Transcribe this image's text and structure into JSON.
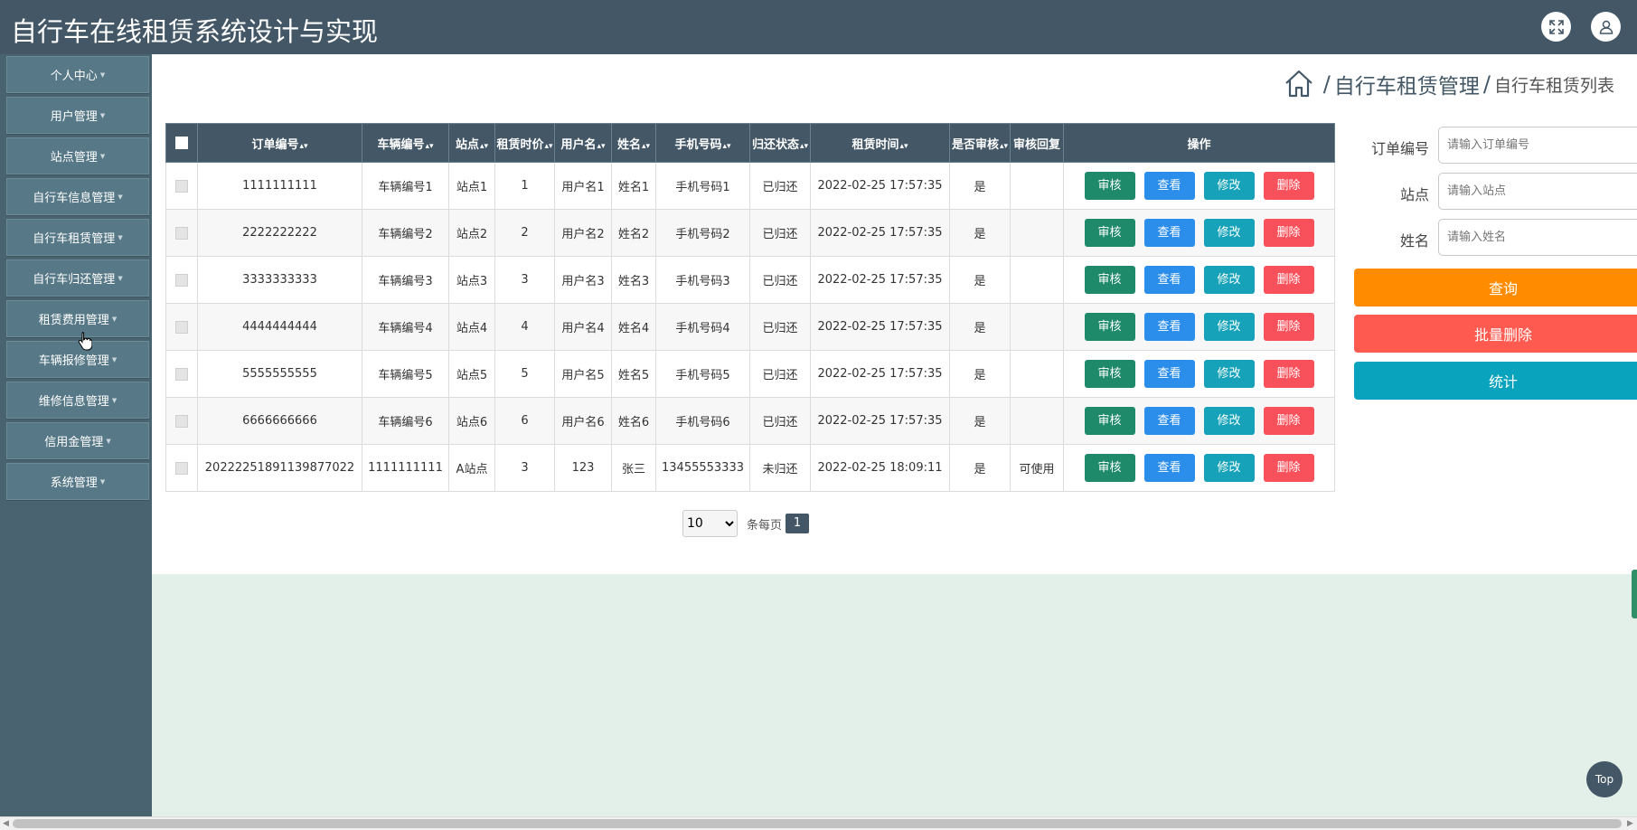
{
  "app": {
    "title": "自行车在线租赁系统设计与实现"
  },
  "header_icons": [
    "fullscreen-icon",
    "user-icon"
  ],
  "sidebar": {
    "items": [
      {
        "label": "个人中心"
      },
      {
        "label": "用户管理"
      },
      {
        "label": "站点管理"
      },
      {
        "label": "自行车信息管理"
      },
      {
        "label": "自行车租赁管理"
      },
      {
        "label": "自行车归还管理"
      },
      {
        "label": "租赁费用管理"
      },
      {
        "label": "车辆报修管理"
      },
      {
        "label": "维修信息管理"
      },
      {
        "label": "信用金管理"
      },
      {
        "label": "系统管理"
      }
    ]
  },
  "breadcrumb": {
    "section": "自行车租赁管理",
    "page": "自行车租赁列表",
    "separator": "/"
  },
  "table": {
    "columns": [
      "订单编号",
      "车辆编号",
      "站点",
      "租赁时价",
      "用户名",
      "姓名",
      "手机号码",
      "归还状态",
      "租赁时间",
      "是否审核",
      "审核回复",
      "操作"
    ],
    "actions": {
      "audit": "审核",
      "view": "查看",
      "edit": "修改",
      "delete": "删除"
    },
    "rows": [
      {
        "order": "1111111111",
        "bike": "车辆编号1",
        "station": "站点1",
        "price": "1",
        "username": "用户名1",
        "name": "姓名1",
        "phone": "手机号码1",
        "status": "已归还",
        "time": "2022-02-25 17:57:35",
        "audited": "是",
        "reply": ""
      },
      {
        "order": "2222222222",
        "bike": "车辆编号2",
        "station": "站点2",
        "price": "2",
        "username": "用户名2",
        "name": "姓名2",
        "phone": "手机号码2",
        "status": "已归还",
        "time": "2022-02-25 17:57:35",
        "audited": "是",
        "reply": ""
      },
      {
        "order": "3333333333",
        "bike": "车辆编号3",
        "station": "站点3",
        "price": "3",
        "username": "用户名3",
        "name": "姓名3",
        "phone": "手机号码3",
        "status": "已归还",
        "time": "2022-02-25 17:57:35",
        "audited": "是",
        "reply": ""
      },
      {
        "order": "4444444444",
        "bike": "车辆编号4",
        "station": "站点4",
        "price": "4",
        "username": "用户名4",
        "name": "姓名4",
        "phone": "手机号码4",
        "status": "已归还",
        "time": "2022-02-25 17:57:35",
        "audited": "是",
        "reply": ""
      },
      {
        "order": "5555555555",
        "bike": "车辆编号5",
        "station": "站点5",
        "price": "5",
        "username": "用户名5",
        "name": "姓名5",
        "phone": "手机号码5",
        "status": "已归还",
        "time": "2022-02-25 17:57:35",
        "audited": "是",
        "reply": ""
      },
      {
        "order": "6666666666",
        "bike": "车辆编号6",
        "station": "站点6",
        "price": "6",
        "username": "用户名6",
        "name": "姓名6",
        "phone": "手机号码6",
        "status": "已归还",
        "time": "2022-02-25 17:57:35",
        "audited": "是",
        "reply": ""
      },
      {
        "order": "20222251891139877022",
        "bike": "1111111111",
        "station": "A站点",
        "price": "3",
        "username": "123",
        "name": "张三",
        "phone": "13455553333",
        "status": "未归还",
        "time": "2022-02-25 18:09:11",
        "audited": "是",
        "reply": "可使用"
      }
    ]
  },
  "pagination": {
    "page_size": "10",
    "per_page_label": "条每页",
    "current_page": "1"
  },
  "filters": {
    "order": {
      "label": "订单编号",
      "placeholder": "请输入订单编号"
    },
    "station": {
      "label": "站点",
      "placeholder": "请输入站点"
    },
    "name": {
      "label": "姓名",
      "placeholder": "请输入姓名"
    }
  },
  "buttons": {
    "search": "查询",
    "batch_delete": "批量删除",
    "stats": "统计",
    "top": "Top"
  },
  "colors": {
    "primary": "#435766",
    "search": "#ff8c00",
    "batch_delete": "#ff5a4f",
    "stats": "#0aa3bd",
    "audit": "#1e8a6a",
    "view": "#2b8eea",
    "edit": "#16a2b8",
    "delete": "#f9515b"
  }
}
